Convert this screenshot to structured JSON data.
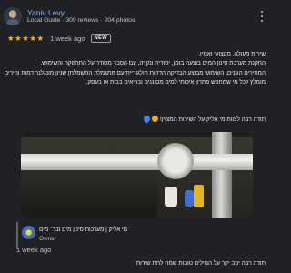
{
  "review": {
    "reviewer": {
      "name": "Yaniv Levy",
      "meta": "Local Guide · 309 reviews · 204 photos"
    },
    "rating": {
      "stars": 5,
      "time": "1 week ago",
      "badge": "NEW",
      "star_color": "#fbbc04"
    },
    "text_lines": [
      "שירות מעולה, מקצועי ואמין.",
      "התקנת מערכת סינון המים בוצעה בזמן, יסודית ונקייה, עם הסבר מסודר על התחזוקה והשימוש.",
      "המחירים הוגנים, השימוש מבוצע הבדיקה הדקות חולגוריית עם מתגמלת החשמלתן שניון מונגלנר דמות והירים",
      "מומלץ לכל מי שמחפש פתרון איכותי למים מסוננים ובריאים בבית או בעסק."
    ],
    "thanks_line": "תודה רבה לצוות מי אליק על השירות המצוין!",
    "thanks_emojis": [
      "folded-hands-emoji",
      "droplet-emoji"
    ],
    "photo": {
      "icon": "photo-under-sink-water-filter"
    }
  },
  "owner_response": {
    "name": "מי אליק | מערכות סינון מים ובר׳ מים",
    "role": "Owner",
    "time": "1 week ago",
    "reply": "תודה רבה יניב יקר על המילים טובות שמח לתת שירות"
  },
  "colors": {
    "background": "#202124",
    "link": "#8ab4f8",
    "text": "#e8eaed",
    "secondary": "#bdc1c6"
  }
}
